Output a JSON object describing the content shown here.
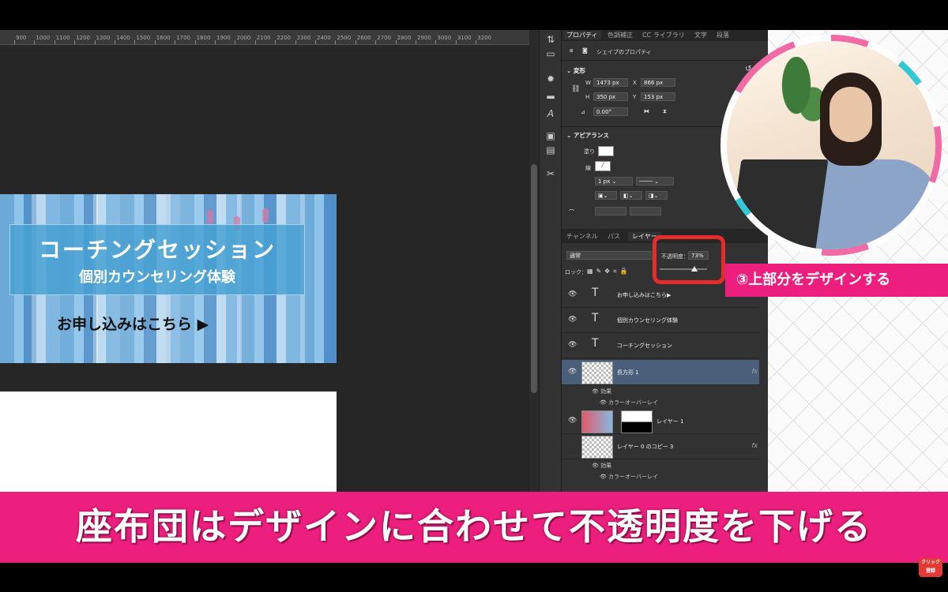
{
  "properties_panel": {
    "tabs": [
      "プロパティ",
      "色調補正",
      "CC ライブラリ",
      "文字",
      "段落"
    ],
    "shape_props_label": "シェイプのプロパティ",
    "transform_section": "変形",
    "w_label": "W",
    "w_value": "1473 px",
    "h_label": "H",
    "h_value": "350 px",
    "x_label": "X",
    "x_value": "866 px",
    "y_label": "Y",
    "y_value": "153 px",
    "angle_value": "0.00°",
    "appearance_section": "アピアランス",
    "fill_label": "塗り",
    "stroke_label": "線",
    "stroke_width": "1 px"
  },
  "layers_panel": {
    "tabs": [
      "チャンネル",
      "パス",
      "レイヤー"
    ],
    "blend_mode": "通常",
    "opacity_label": "不透明度：",
    "opacity_value": "73%",
    "opacity_fraction": 0.73,
    "lock_label": "ロック：",
    "layers": [
      {
        "name": "お申し込みはこちら▶",
        "type": "text"
      },
      {
        "name": "個別カウンセリング体験",
        "type": "text"
      },
      {
        "name": "コーチングセッション",
        "type": "text"
      },
      {
        "name": "長方形 1",
        "type": "shape",
        "selected": true,
        "fx": "fx",
        "effects_label": "効果",
        "effect": "カラーオーバーレイ"
      },
      {
        "name": "レイヤー 1",
        "type": "image"
      },
      {
        "name": "レイヤー 0 のコピー 3",
        "type": "image",
        "fx": "fx",
        "effects_label": "効果",
        "effect": "カラーオーバーレイ"
      }
    ]
  },
  "banner": {
    "title": "コーチングセッション",
    "subtitle": "個別カウンセリング体験",
    "cta": "お申し込みはこちら ▶"
  },
  "ruler_ticks": [
    "900",
    "1000",
    "1100",
    "1200",
    "1300",
    "1400",
    "1500",
    "1600",
    "1700",
    "1800",
    "1900",
    "2000",
    "2100",
    "2200",
    "2300",
    "2400",
    "2500",
    "2600",
    "2700",
    "2800",
    "2900",
    "3000",
    "3100",
    "3200"
  ],
  "step_label": "③上部分をデザインする",
  "caption": "座布団はデザインに合わせて不透明度を下げる",
  "subscribe_label": "クリック 登録",
  "colors": {
    "accent": "#ec1f7e",
    "highlight": "#e62b2b",
    "selected_layer": "#4a5f7a"
  }
}
